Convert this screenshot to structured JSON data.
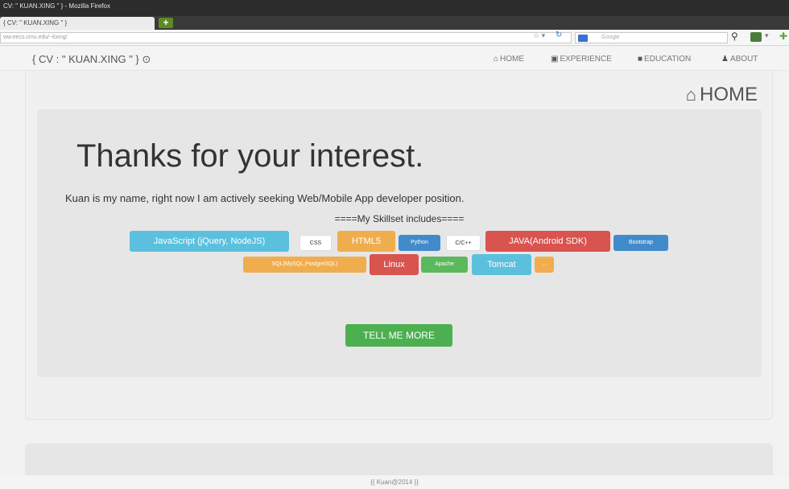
{
  "browser": {
    "window_title": "CV: \" KUAN.XING \" } - Mozilla Firefox",
    "tab_label": "{ CV: \" KUAN.XING \" }",
    "new_tab_label": "+",
    "url": "ww.eecs.cmu.edu/~kxing/",
    "search_placeholder": "Google"
  },
  "site": {
    "brand": "{ CV : \" KUAN.XING \" } ⊙",
    "nav": [
      {
        "icon": "home-icon",
        "label": "HOME"
      },
      {
        "icon": "briefcase-icon",
        "label": "EXPERIENCE"
      },
      {
        "icon": "book-icon",
        "label": "EDUCATION"
      },
      {
        "icon": "user-icon",
        "label": "ABOUT"
      }
    ]
  },
  "main": {
    "section_title": "HOME",
    "headline": "Thanks for your interest.",
    "intro": "Kuan is my name, right now I am actively seeking Web/Mobile App developer position.",
    "skillset_heading": "====My Skillset includes====",
    "skills": [
      {
        "label": "JavaScript (jQuery, NodeJS)",
        "color": "#5bc0de"
      },
      {
        "label": "CSS",
        "color": "#ffffff"
      },
      {
        "label": "HTML5",
        "color": "#f0ad4e"
      },
      {
        "label": "Python",
        "color": "#428bca"
      },
      {
        "label": "C/C++",
        "color": "#ffffff"
      },
      {
        "label": "JAVA(Android SDK)",
        "color": "#d9534f"
      },
      {
        "label": "Bootstrap",
        "color": "#428bca"
      },
      {
        "label": "SQL(MySQL,PostgreSQL)",
        "color": "#f0ad4e"
      },
      {
        "label": "Linux",
        "color": "#d9534f"
      },
      {
        "label": "Apache",
        "color": "#5cb85c"
      },
      {
        "label": "Tomcat",
        "color": "#5bc0de"
      },
      {
        "label": "...",
        "color": "#f0ad4e"
      }
    ],
    "cta_label": "TELL ME MORE"
  },
  "footer": {
    "text": "{{ Kuan@2014 }}"
  }
}
